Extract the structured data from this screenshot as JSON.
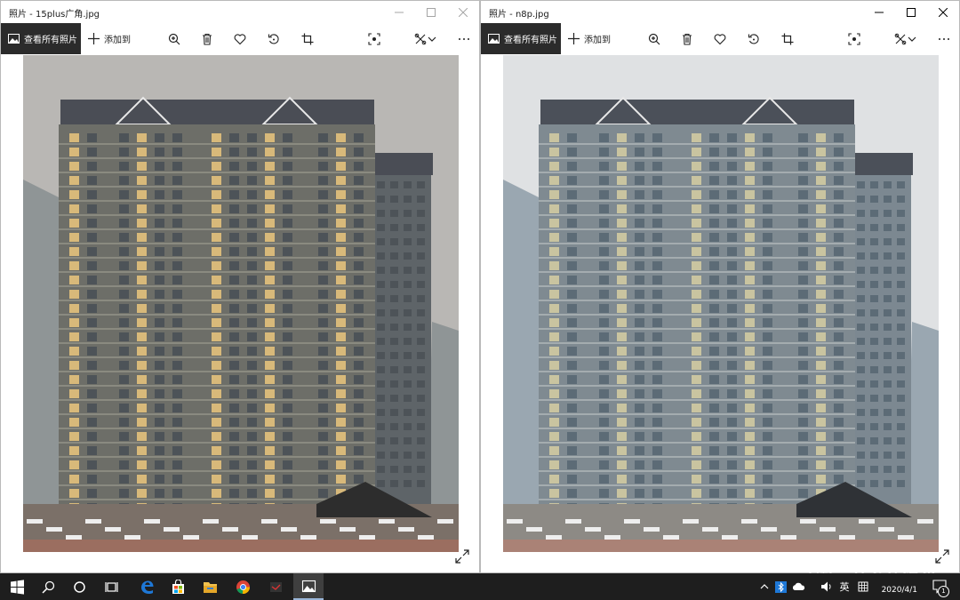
{
  "window_left": {
    "title": "照片 - 15plus广角.jpg",
    "toolbar": {
      "view_all": "查看所有照片",
      "add_to": "添加到"
    }
  },
  "window_right": {
    "title": "照片 - n8p.jpg",
    "toolbar": {
      "view_all": "查看所有照片",
      "add_to": "添加到"
    }
  },
  "icons": {
    "toolbar": [
      "photos-icon",
      "plus-icon",
      "zoom-in-icon",
      "delete-icon",
      "heart-icon",
      "rotate-icon",
      "crop-icon",
      "enhance-icon",
      "edit-icon",
      "chevron-down-icon",
      "more-icon"
    ],
    "window_controls": [
      "minimize-icon",
      "maximize-icon",
      "close-icon"
    ],
    "taskbar": [
      "windows-start-icon",
      "search-icon",
      "cortana-icon",
      "task-view-icon",
      "edge-icon",
      "store-icon",
      "file-explorer-icon",
      "chrome-icon",
      "app-icon",
      "photos-icon"
    ],
    "tray": [
      "up-chevron-icon",
      "bluetooth-icon",
      "onedrive-icon",
      "speaker-icon",
      "keyboard-icon",
      "notification-icon"
    ]
  },
  "taskbar": {
    "ime_label": "英",
    "date": "2020/4/1",
    "notification_count": "1"
  },
  "watermark": {
    "text": "什么值得买"
  },
  "colors": {
    "taskbar_bg": "#1e1e1e",
    "view_all_bg": "#2b2b2b",
    "edge_blue": "#1e78d7",
    "left_photo_tint": "#d8b97a",
    "right_photo_tint": "#c9c4a0"
  }
}
